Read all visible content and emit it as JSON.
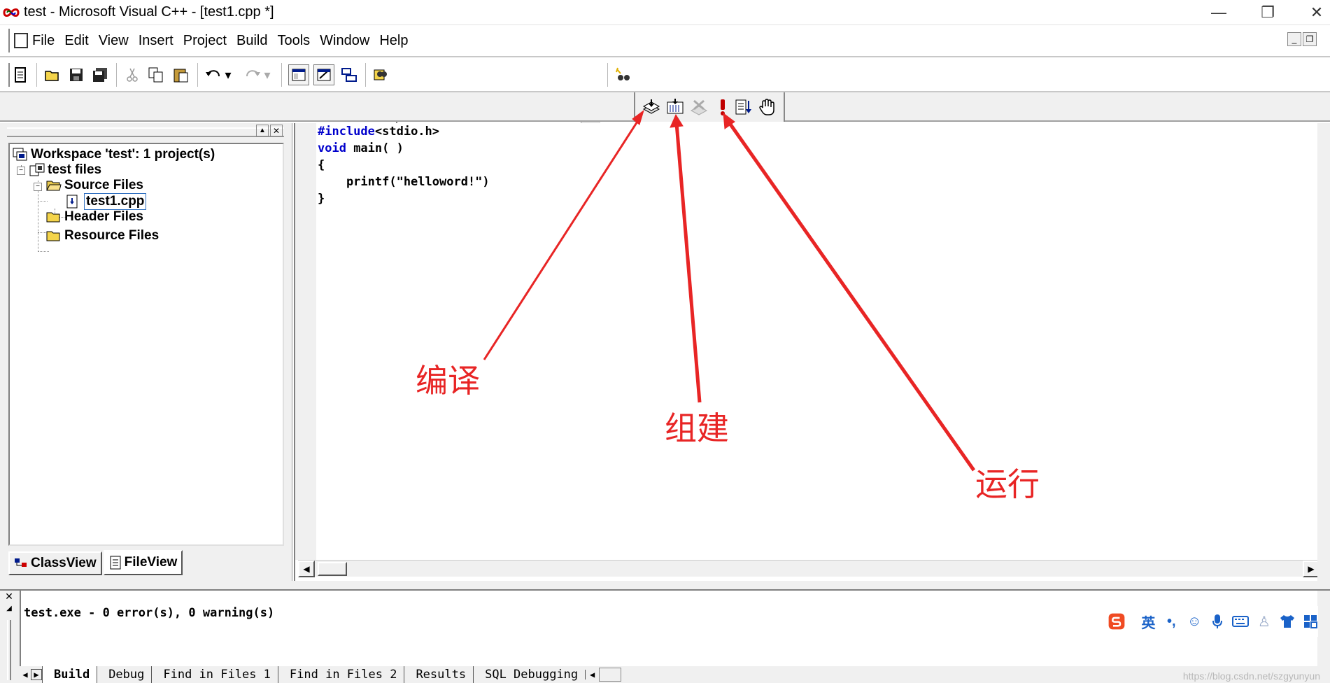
{
  "window": {
    "title": "test - Microsoft Visual C++ - [test1.cpp *]",
    "controls": [
      "minimize",
      "restore",
      "close"
    ]
  },
  "menu": [
    "File",
    "Edit",
    "View",
    "Insert",
    "Project",
    "Build",
    "Tools",
    "Window",
    "Help"
  ],
  "toolbar": {
    "find_combo_value": ""
  },
  "workspace": {
    "root": "Workspace 'test': 1 project(s)",
    "project": "test files",
    "source_folder": "Source Files",
    "source_file": "test1.cpp",
    "header_folder": "Header Files",
    "resource_folder": "Resource Files",
    "tabs": [
      "ClassView",
      "FileView"
    ],
    "active_tab": "FileView"
  },
  "editor": {
    "lines": [
      {
        "kw": "#include",
        "rest": "<stdio.h>"
      },
      {
        "kw": "void",
        "rest": " main( )"
      },
      {
        "kw": "",
        "rest": "{"
      },
      {
        "kw": "",
        "rest": "    printf(\"helloword!\")"
      },
      {
        "kw": "",
        "rest": "}"
      }
    ]
  },
  "output": {
    "message": "test.exe - 0 error(s), 0 warning(s)",
    "tabs": [
      "Build",
      "Debug",
      "Find in Files 1",
      "Find in Files 2",
      "Results",
      "SQL Debugging"
    ],
    "active_tab": "Build"
  },
  "annotations": {
    "compile": "编译",
    "build": "组建",
    "run": "运行"
  },
  "ime": {
    "mode": "英"
  },
  "watermark": "https://blog.csdn.net/szgyunyun",
  "colors": {
    "annotation": "#e82525",
    "keyword": "#0000cc"
  }
}
